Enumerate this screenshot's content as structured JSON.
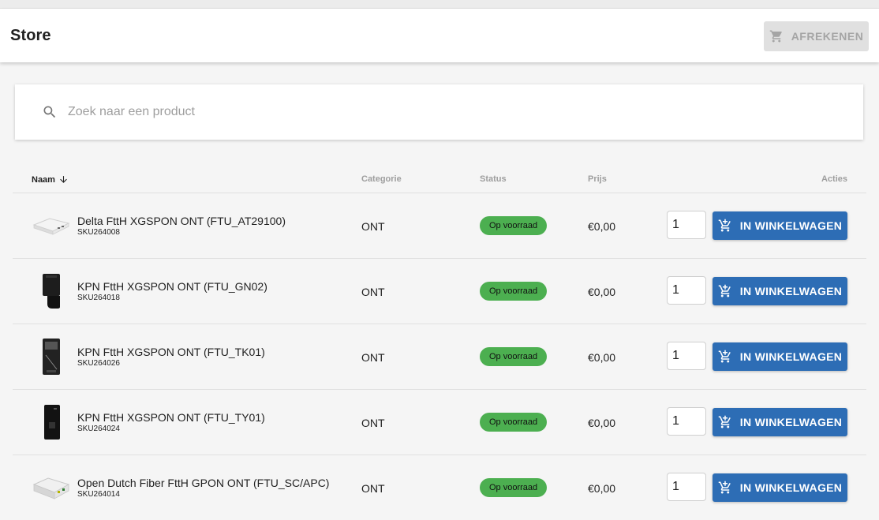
{
  "header": {
    "title": "Store",
    "checkout_label": "AFREKENEN"
  },
  "search": {
    "placeholder": "Zoek naar een product"
  },
  "table": {
    "columns": {
      "name": "Naam",
      "category": "Categorie",
      "status": "Status",
      "price": "Prijs",
      "actions": "Acties"
    },
    "add_label": "IN WINKELWAGEN",
    "rows": [
      {
        "name": "Delta FttH XGSPON ONT (FTU_AT29100)",
        "sku": "SKU264008",
        "category": "ONT",
        "status": "Op voorraad",
        "price": "€0,00",
        "qty": "1",
        "image": "white-flat-ont"
      },
      {
        "name": "KPN FttH XGSPON ONT (FTU_GN02)",
        "sku": "SKU264018",
        "category": "ONT",
        "status": "Op voorraad",
        "price": "€0,00",
        "qty": "1",
        "image": "black-wall-ont"
      },
      {
        "name": "KPN FttH XGSPON ONT (FTU_TK01)",
        "sku": "SKU264026",
        "category": "ONT",
        "status": "Op voorraad",
        "price": "€0,00",
        "qty": "1",
        "image": "black-panel-ont"
      },
      {
        "name": "KPN FttH XGSPON ONT (FTU_TY01)",
        "sku": "SKU264024",
        "category": "ONT",
        "status": "Op voorraad",
        "price": "€0,00",
        "qty": "1",
        "image": "black-tower-ont"
      },
      {
        "name": "Open Dutch Fiber FttH GPON ONT (FTU_SC/APC)",
        "sku": "SKU264014",
        "category": "ONT",
        "status": "Op voorraad",
        "price": "€0,00",
        "qty": "1",
        "image": "white-box-ont"
      }
    ]
  },
  "colors": {
    "primary": "#2d6db5",
    "status_in_stock": "#4caf50",
    "disabled_button": "#e0e0e0"
  }
}
